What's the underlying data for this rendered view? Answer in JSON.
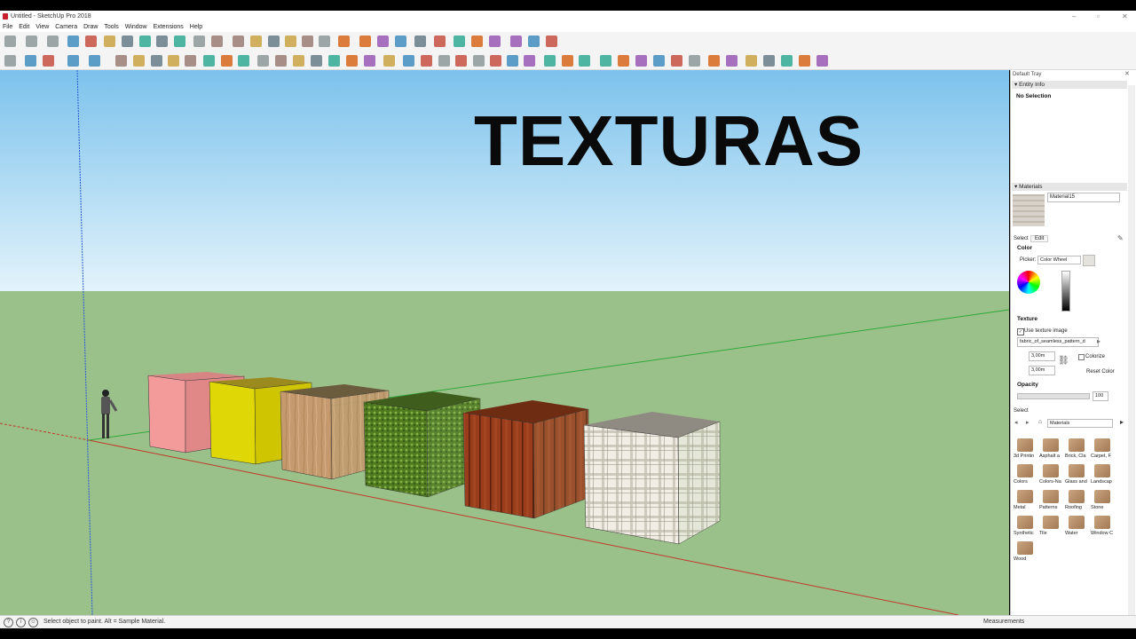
{
  "window": {
    "title": "Untitled - SketchUp Pro 2018"
  },
  "menu": [
    "File",
    "Edit",
    "View",
    "Camera",
    "Draw",
    "Tools",
    "Window",
    "Extensions",
    "Help"
  ],
  "viewport": {
    "title_text": "TEXTURAS"
  },
  "status": {
    "message": "Select object to paint. Alt = Sample Material.",
    "measurements_label": "Measurements"
  },
  "tray": {
    "title": "Default Tray",
    "entity_info": {
      "header": "Entity Info",
      "selection": "No Selection"
    },
    "materials": {
      "header": "Materials",
      "material_name": "Material15",
      "tabs": {
        "select": "Select",
        "edit": "Edit"
      },
      "color_label": "Color",
      "picker_label": "Picker:",
      "picker_value": "Color Wheel",
      "texture_label": "Texture",
      "use_texture_label": "Use texture image",
      "texture_file": "fabric_of_seamless_pattern_d",
      "width": "3,00m",
      "height": "3,00m",
      "colorize_label": "Colorize",
      "reset_color_label": "Reset Color",
      "opacity_label": "Opacity",
      "opacity_value": "100"
    },
    "select_section": {
      "label": "Select",
      "collection": "Materials",
      "items": [
        "3d Printin",
        "Asphalt a",
        "Brick, Cla",
        "Carpet, F",
        "Colors",
        "Colors-Na",
        "Glass and",
        "Landscap",
        "Metal",
        "Patterns",
        "Roofing",
        "Stone",
        "Synthetic",
        "Tile",
        "Water",
        "Window C",
        "Wood"
      ]
    }
  },
  "colors": {
    "sky_top": "#7cc2ec",
    "ground": "#9bc18a",
    "red_axis": "#c0392b",
    "green_axis": "#2eaa3a",
    "blue_axis": "#2a5bd7"
  }
}
